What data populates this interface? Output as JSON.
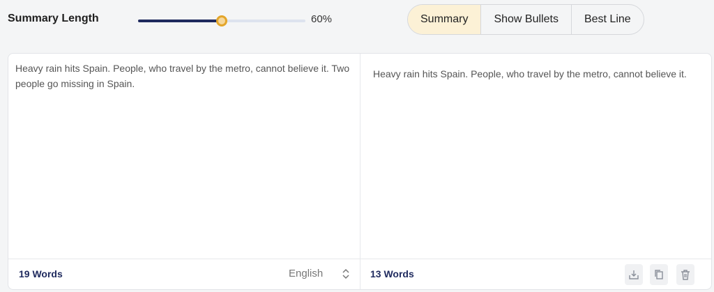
{
  "summary_length": {
    "label": "Summary Length",
    "value_percent": 60,
    "value_text": "60%",
    "colors": {
      "fill": "#1f2a5e",
      "track": "#dde3ee",
      "thumb": "#e3a52a"
    }
  },
  "modes": {
    "items": [
      "Summary",
      "Show Bullets",
      "Best Line"
    ],
    "selected": "Summary",
    "active_color": "#fcf1d6"
  },
  "input": {
    "text": "Heavy rain hits Spain. People, who travel by the metro, cannot believe it. Two people go missing in Spain.",
    "word_count": "19 Words",
    "language": "English"
  },
  "output": {
    "text": "Heavy rain hits Spain. People, who travel by the metro, cannot believe it.",
    "word_count": "13 Words",
    "actions": [
      "download-icon",
      "copy-icon",
      "trash-icon"
    ]
  }
}
